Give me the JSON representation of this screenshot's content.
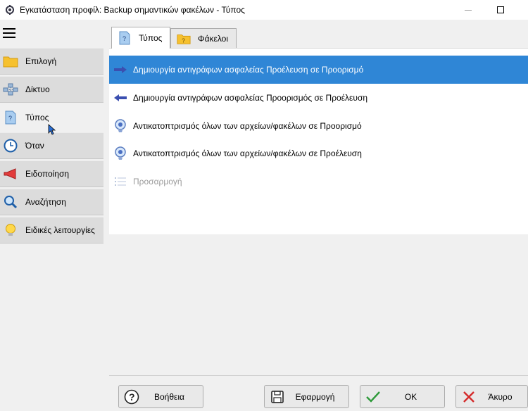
{
  "window": {
    "title": "Εγκατάσταση προφίλ: Backup σημαντικών φακέλων - Τύπος",
    "icons": {
      "app": "gear-app-icon",
      "minimize": "minimize-icon",
      "maximize": "maximize-icon"
    }
  },
  "sidebar": {
    "menu_icon": "hamburger-icon",
    "items": [
      {
        "label": "Επιλογή",
        "icon": "folder-icon",
        "active": false
      },
      {
        "label": "Δίκτυο",
        "icon": "network-icon",
        "active": false
      },
      {
        "label": "Τύπος",
        "icon": "question-file-icon",
        "active": true
      },
      {
        "label": "Όταν",
        "icon": "clock-icon",
        "active": false
      },
      {
        "label": "Ειδοποίηση",
        "icon": "megaphone-icon",
        "active": false
      },
      {
        "label": "Αναζήτηση",
        "icon": "magnifier-icon",
        "active": false
      },
      {
        "label": "Ειδικές λειτουργίες",
        "icon": "lightbulb-icon",
        "active": false
      }
    ]
  },
  "tabs": [
    {
      "label": "Τύπος",
      "icon": "question-file-icon",
      "active": true
    },
    {
      "label": "Φάκελοι",
      "icon": "question-folder-icon",
      "active": false
    }
  ],
  "options": [
    {
      "label": "Δημιουργία αντιγράφων ασφαλείας Προέλευση σε Προορισμό",
      "icon": "arrow-right-icon",
      "selected": true,
      "disabled": false
    },
    {
      "label": "Δημιουργία αντιγράφων ασφαλείας Προορισμός σε Προέλευση",
      "icon": "arrow-left-icon",
      "selected": false,
      "disabled": false
    },
    {
      "label": "Αντικατοπτρισμός όλων των αρχείων/φακέλων σε Προορισμό",
      "icon": "mirror-icon",
      "selected": false,
      "disabled": false
    },
    {
      "label": "Αντικατοπτρισμός όλων των αρχείων/φακέλων σε Προέλευση",
      "icon": "mirror-icon",
      "selected": false,
      "disabled": false
    },
    {
      "label": "Προσαρμογή",
      "icon": "list-icon",
      "selected": false,
      "disabled": true
    }
  ],
  "buttons": {
    "help": {
      "label": "Βοήθεια",
      "icon": "question-icon"
    },
    "apply": {
      "label": "Εφαρμογή",
      "icon": "save-icon"
    },
    "ok": {
      "label": "OK",
      "icon": "checkmark-icon"
    },
    "cancel": {
      "label": "Άκυρο",
      "icon": "x-icon"
    }
  },
  "colors": {
    "selection": "#2f86d6",
    "arrow": "#3b4fb0",
    "disabled_text": "#9a9a9a"
  }
}
